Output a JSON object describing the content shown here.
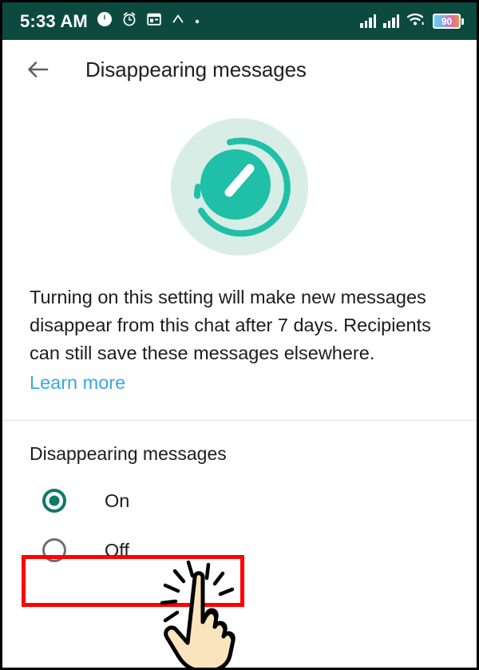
{
  "status_bar": {
    "time": "5:33 AM",
    "left_icons": [
      "clock-filled-icon",
      "alarm-icon",
      "calendar-icon",
      "chevron-up-icon",
      "dot-icon"
    ],
    "right_icons": [
      "signal-bars-icon",
      "signal-bars-icon",
      "wifi-icon",
      "battery-icon"
    ],
    "battery_level": "90",
    "background_color": "#0c4a40"
  },
  "app_bar": {
    "back_icon": "back-arrow-icon",
    "title": "Disappearing messages"
  },
  "hero": {
    "icon_name": "disappearing-timer-icon",
    "circle_background_color": "#d7ede5",
    "accent_color": "#1fbfa8"
  },
  "description": {
    "body": "Turning on this setting will make new messages disappear from this chat after 7 days. Recipients can still save these messages elsewhere.",
    "learn_more_label": "Learn more",
    "link_color": "#3ba5e5"
  },
  "options": {
    "section_label": "Disappearing messages",
    "items": [
      {
        "label": "On",
        "selected": true
      },
      {
        "label": "Off",
        "selected": false
      }
    ],
    "selected_color": "#0e7a66",
    "unselected_color": "#6f6f6f"
  },
  "annotation": {
    "highlight_color": "#ff0000",
    "highlight_target": "Off",
    "cursor_name": "tapping-hand-cursor",
    "cursor_fill_color": "#fae4be"
  }
}
